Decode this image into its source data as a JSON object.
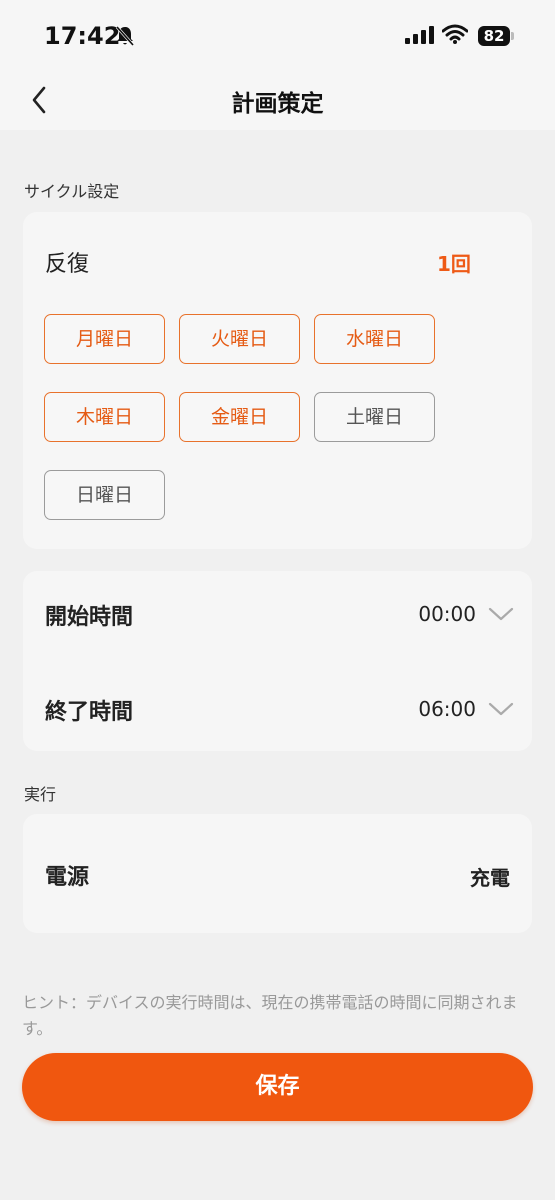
{
  "status_bar": {
    "time": "17:42",
    "battery": "82"
  },
  "nav": {
    "title": "計画策定"
  },
  "cycle": {
    "section_label": "サイクル設定",
    "repeat_label": "反復",
    "repeat_count": "1回",
    "days": [
      {
        "label": "月曜日",
        "selected": true
      },
      {
        "label": "火曜日",
        "selected": true
      },
      {
        "label": "水曜日",
        "selected": true
      },
      {
        "label": "木曜日",
        "selected": true
      },
      {
        "label": "金曜日",
        "selected": true
      },
      {
        "label": "土曜日",
        "selected": false
      },
      {
        "label": "日曜日",
        "selected": false
      }
    ]
  },
  "time_settings": {
    "start_label": "開始時間",
    "start_value": "00:00",
    "end_label": "終了時間",
    "end_value": "06:00"
  },
  "execution": {
    "section_label": "実行",
    "power_label": "電源",
    "power_value": "充電"
  },
  "hint": "ヒント：デバイスの実行時間は、現在の携帯電話の時間に同期されます。",
  "save_label": "保存",
  "colors": {
    "accent": "#f0570f",
    "selected_text": "#e55b14",
    "background": "#f0f0f0",
    "card": "#f6f6f6"
  }
}
